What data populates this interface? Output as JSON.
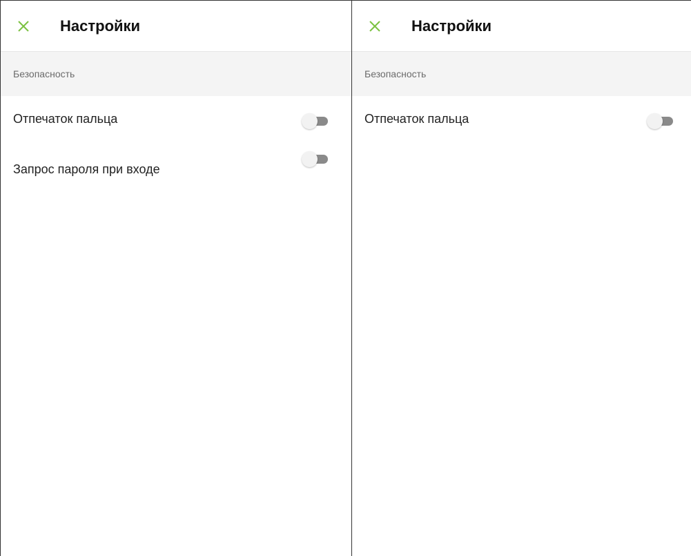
{
  "colors": {
    "accent": "#7cc242",
    "section_bg": "#f4f4f4",
    "toggle_track_off": "#8a8a8a",
    "toggle_thumb": "#f2f2f2"
  },
  "panels": [
    {
      "header": {
        "close_icon": "close-icon",
        "title": "Настройки"
      },
      "section": {
        "title": "Безопасность"
      },
      "items": [
        {
          "label": "Отпечаток пальца",
          "enabled": false
        },
        {
          "label": "Запрос пароля при входе",
          "enabled": false
        }
      ]
    },
    {
      "header": {
        "close_icon": "close-icon",
        "title": "Настройки"
      },
      "section": {
        "title": "Безопасность"
      },
      "items": [
        {
          "label": "Отпечаток пальца",
          "enabled": false
        }
      ]
    }
  ]
}
